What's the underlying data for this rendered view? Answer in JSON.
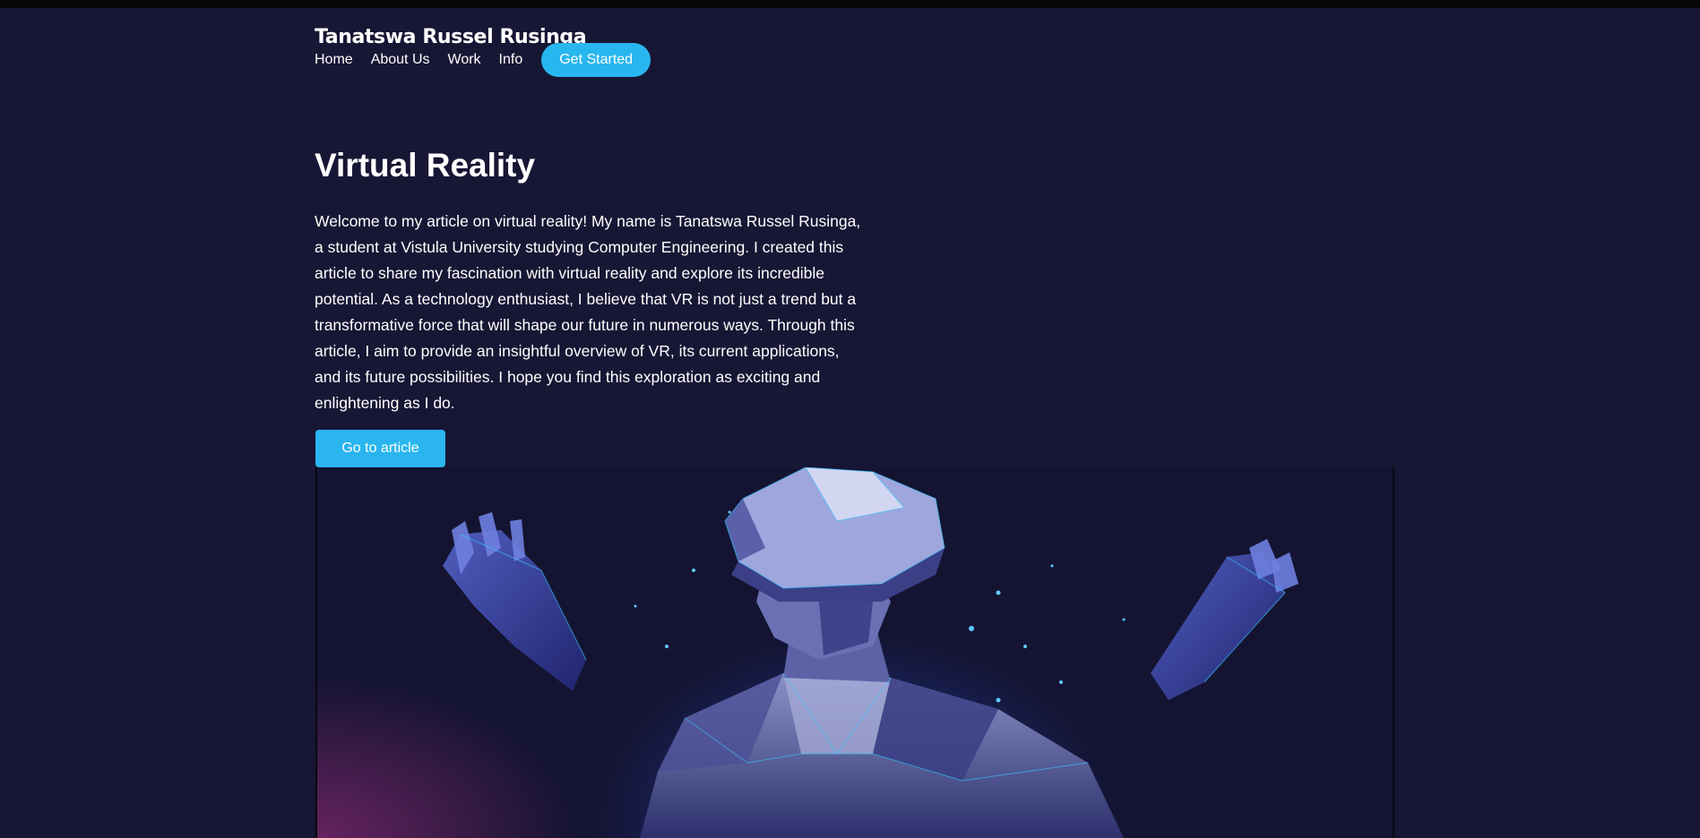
{
  "site": {
    "brand": "Tanatswa Russel Rusinga"
  },
  "nav": {
    "items": [
      "Home",
      "About Us",
      "Work",
      "Info"
    ],
    "cta_label": "Get Started"
  },
  "hero": {
    "title": "Virtual Reality",
    "intro": "Welcome to my article on virtual reality! My name is Tanatswa Russel Rusinga, a student at Vistula University studying Computer Engineering. I created this article to share my fascination with virtual reality and explore its incredible potential. As a technology enthusiast, I believe that VR is not just a trend but a transformative force that will shape our future in numerous ways. Through this article, I aim to provide an insightful overview of VR, its current applications, and its future possibilities. I hope you find this exploration as exciting and enlightening as I do.",
    "button_label": "Go to article"
  },
  "colors": {
    "background": "#171634",
    "accent": "#28b6ef",
    "text": "#ffffff"
  }
}
